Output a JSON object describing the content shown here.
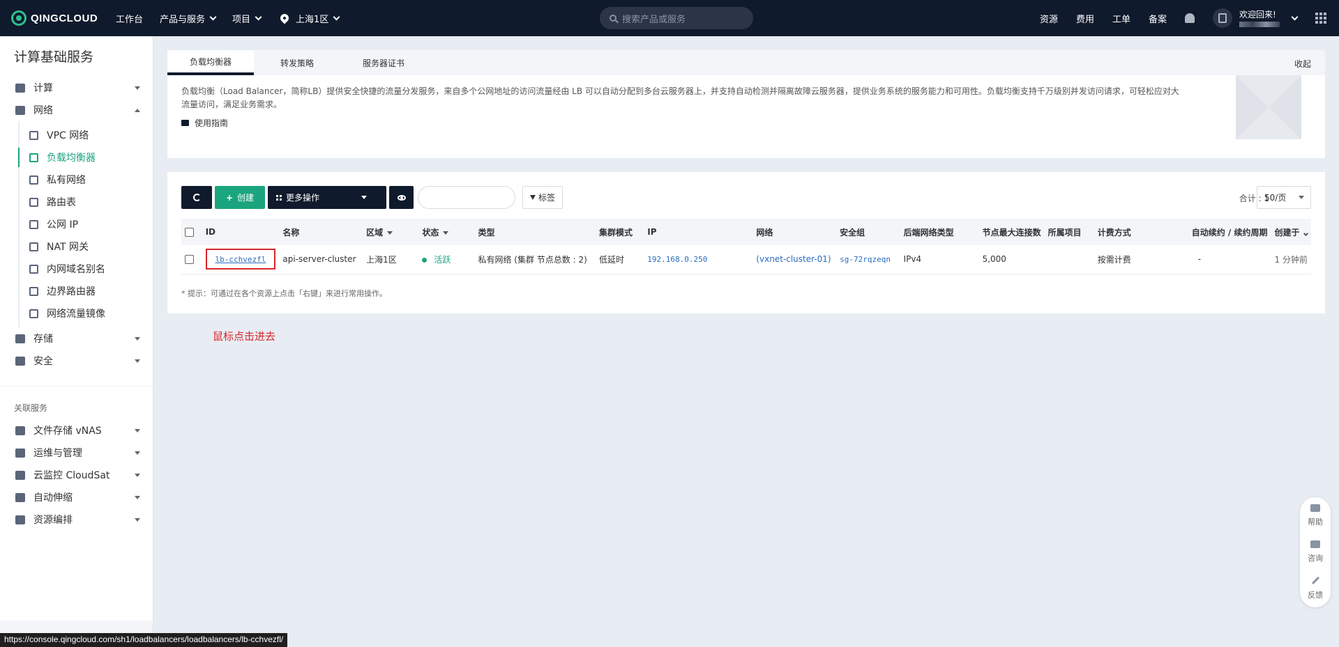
{
  "header": {
    "logo": "QINGCLOUD",
    "nav": [
      "工作台",
      "产品与服务",
      "项目",
      "上海1区"
    ],
    "search_placeholder": "搜索产品或服务",
    "right_links": [
      "资源",
      "费用",
      "工单",
      "备案"
    ],
    "welcome": "欢迎回来!"
  },
  "sidebar": {
    "title": "计算基础服务",
    "groups": {
      "compute": "计算",
      "network": "网络",
      "storage": "存储",
      "security": "安全"
    },
    "network_items": [
      "VPC 网络",
      "负载均衡器",
      "私有网络",
      "路由表",
      "公网 IP",
      "NAT 网关",
      "内网域名别名",
      "边界路由器",
      "网络流量镜像"
    ],
    "related_title": "关联服务",
    "related_items": [
      "文件存储 vNAS",
      "运维与管理",
      "云监控 CloudSat",
      "自动伸缩",
      "资源编排"
    ]
  },
  "tabs": [
    "负载均衡器",
    "转发策略",
    "服务器证书"
  ],
  "collapse_label": "收起",
  "description": "负载均衡（Load Balancer，简称LB）提供安全快捷的流量分发服务，来自多个公网地址的访问流量经由 LB 可以自动分配到多台云服务器上，并支持自动检测并隔离故障云服务器，提供业务系统的服务能力和可用性。负载均衡支持千万级别并发访问请求，可轻松应对大流量访问，满足业务需求。",
  "guide_label": "使用指南",
  "toolbar": {
    "create_label": "创建",
    "more_label": "更多操作",
    "tag_label": "标签",
    "total_label": "合计 : 1",
    "page_size": "50/页"
  },
  "table": {
    "headers": [
      "ID",
      "名称",
      "区域",
      "状态",
      "类型",
      "集群模式",
      "IP",
      "网络",
      "安全组",
      "后端网络类型",
      "节点最大连接数",
      "所属项目",
      "计费方式",
      "自动续约 / 续约周期",
      "创建于"
    ],
    "row": {
      "id": "lb-cchvezfl",
      "name": "api-server-cluster",
      "zone": "上海1区",
      "status": "活跃",
      "type": "私有网络 (集群 节点总数 : 2)",
      "cluster_mode": "低延时",
      "ip": "192.168.0.250",
      "network": "(vxnet-cluster-01)",
      "security_group": "sg-72rqzeqn",
      "backend_type": "IPv4",
      "max_conn": "5,000",
      "project": "",
      "billing": "按需计费",
      "auto_renew": "-",
      "created": "1 分钟前"
    }
  },
  "tip": "* 提示：可通过在各个资源上点击「右键」来进行常用操作。",
  "annotation": "鼠标点击进去",
  "float_bar": [
    "帮助",
    "咨询",
    "反馈"
  ],
  "status_url": "https://console.qingcloud.com/sh1/loadbalancers/loadbalancers/lb-cchvezfl/",
  "colors": {
    "accent": "#1ba57e",
    "topbar": "#0f1a2c",
    "annotation": "#d8262b",
    "link": "#2a6cc0"
  }
}
